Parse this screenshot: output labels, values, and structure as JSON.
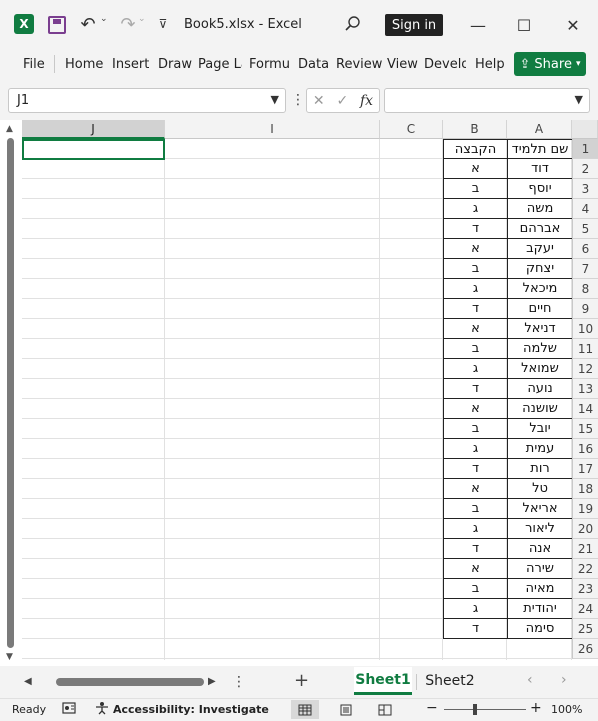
{
  "titlebar": {
    "app_icon_letter": "X",
    "title": "Book5.xlsx  -  Excel",
    "signin": "Sign in",
    "minimize": "—",
    "maximize": "☐",
    "close": "✕"
  },
  "ribbon": {
    "tabs": [
      "File",
      "Home",
      "Insert",
      "Draw",
      "Page La",
      "Formul",
      "Data",
      "Review",
      "View",
      "Develo",
      "Help"
    ],
    "share": "Share"
  },
  "formula": {
    "namebox": "J1",
    "fx": "fx",
    "cancel": "✕",
    "enter": "✓",
    "content": ""
  },
  "columns": [
    {
      "label": "J",
      "selected": true
    },
    {
      "label": "I",
      "selected": false
    },
    {
      "label": "C",
      "selected": false
    },
    {
      "label": "B",
      "selected": false
    },
    {
      "label": "A",
      "selected": false
    }
  ],
  "rows": [
    "1",
    "2",
    "3",
    "4",
    "5",
    "6",
    "7",
    "8",
    "9",
    "10",
    "11",
    "12",
    "13",
    "14",
    "15",
    "16",
    "17",
    "18",
    "19",
    "20",
    "21",
    "22",
    "23",
    "24",
    "25",
    "26"
  ],
  "table": {
    "header_A": "שם תלמיד",
    "header_B": "הקבצה",
    "names": [
      "דוד",
      "יוסף",
      "משה",
      "אברהם",
      "יעקב",
      "יצחק",
      "מיכאל",
      "חיים",
      "דניאל",
      "שלמה",
      "שמואל",
      "נועה",
      "שושנה",
      "יובל",
      "עמית",
      "רות",
      "טל",
      "אריאל",
      "ליאור",
      "אנה",
      "שירה",
      "מאיה",
      "יהודית",
      "סימה"
    ],
    "groups": [
      "א",
      "ב",
      "ג",
      "ד",
      "א",
      "ב",
      "ג",
      "ד",
      "א",
      "ב",
      "ג",
      "ד",
      "א",
      "ב",
      "ג",
      "ד",
      "א",
      "ב",
      "ג",
      "ד",
      "א",
      "ב",
      "ג",
      "ד"
    ]
  },
  "sheets": {
    "active": "Sheet1",
    "other": "Sheet2",
    "add": "+"
  },
  "status": {
    "ready": "Ready",
    "accessibility": "Accessibility: Investigate",
    "zoom": "100%",
    "zoom_minus": "−",
    "zoom_plus": "+"
  },
  "colors": {
    "excel_green": "#107c41",
    "border": "#222222"
  }
}
